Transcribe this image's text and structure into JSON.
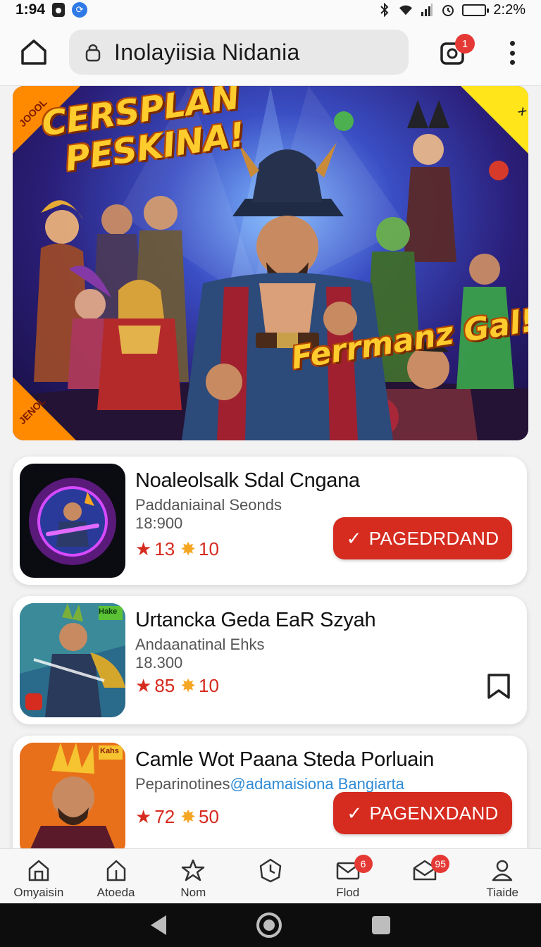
{
  "status_bar": {
    "time": "1:94",
    "battery_text": "2:2%",
    "battery_level": 0.8,
    "icons": [
      "lock-icon",
      "assistant-icon",
      "bluetooth-icon",
      "wifi-icon",
      "signal-icon",
      "alarm-icon",
      "battery-icon"
    ]
  },
  "app_bar": {
    "url_text": "Inolayiisia Nidania",
    "tabs_badge": "1",
    "icons": [
      "home-icon",
      "lock-icon",
      "tabs-icon",
      "more-vert-icon"
    ]
  },
  "banner": {
    "title_line1": "CERSPLAN",
    "title_line2": "PESKINA!",
    "tagline": "Ferrmanz Gal!",
    "corner_tl": "JOOOL",
    "corner_tr": "X",
    "corner_bl": "JENOL"
  },
  "games": [
    {
      "title": "Noaleolsalk Sdal Cngana",
      "subtitle": "Paddaniainal Seonds",
      "count": "18:900",
      "rating_a": "13",
      "rating_b": "10",
      "action": "PAGEDRDAND",
      "action_icon": "check-icon"
    },
    {
      "title": "Urtancka Geda EaR Szyah",
      "subtitle": "Andaanatinal Ehks",
      "count": "18.300",
      "rating_a": "85",
      "rating_b": "10",
      "thumb_tag": "Hake",
      "action_icon": "bookmark-icon"
    },
    {
      "title": "Camle Wot Paana Steda Porluain",
      "subtitle": "Peparinotines",
      "mention": "@adamaisiona Bangiarta",
      "rating_a": "72",
      "rating_b": "50",
      "thumb_tag": "Kahs",
      "action": "PAGENXDAND",
      "action_icon": "check-icon"
    }
  ],
  "bottom_nav": {
    "items": [
      {
        "label": "Omyaisin",
        "icon": "home-outline-icon",
        "badge": ""
      },
      {
        "label": "Atoeda",
        "icon": "home-alt-icon",
        "badge": ""
      },
      {
        "label": "Nom",
        "icon": "star-outline-icon",
        "badge": ""
      },
      {
        "label": "",
        "icon": "compass-icon",
        "badge": ""
      },
      {
        "label": "Flod",
        "icon": "mail-icon",
        "badge": "6"
      },
      {
        "label": "",
        "icon": "mail-open-icon",
        "badge": "95"
      },
      {
        "label": "Tiaide",
        "icon": "person-icon",
        "badge": ""
      }
    ]
  },
  "colors": {
    "accent_red": "#d62b1f",
    "badge_red": "#e53935",
    "star_gold": "#f5a623",
    "link_blue": "#2f8bd6"
  }
}
